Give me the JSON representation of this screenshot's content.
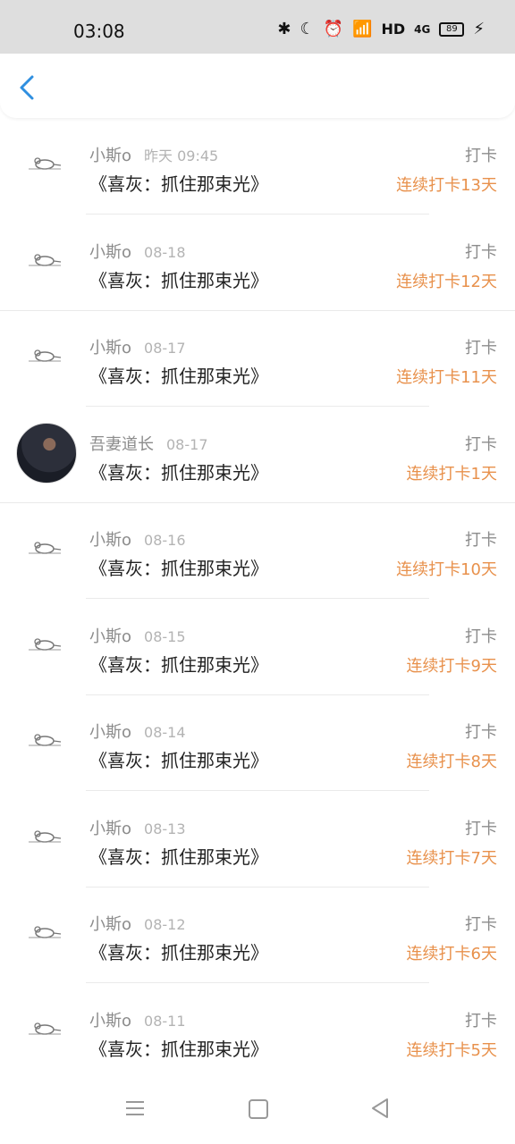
{
  "status": {
    "time": "03:08",
    "hd": "HD",
    "network": "4G",
    "battery": "89"
  },
  "header": {
    "back_label": "<"
  },
  "items": [
    {
      "user": "小斯o",
      "date": "昨天 09:45",
      "title": "《喜灰：抓住那束光》",
      "label": "打卡",
      "streak": "连续打卡13天",
      "avatar": "mouse-icon"
    },
    {
      "user": "小斯o",
      "date": "08-18",
      "title": "《喜灰：抓住那束光》",
      "label": "打卡",
      "streak": "连续打卡12天",
      "avatar": "mouse-icon"
    },
    {
      "user": "小斯o",
      "date": "08-17",
      "title": "《喜灰：抓住那束光》",
      "label": "打卡",
      "streak": "连续打卡11天",
      "avatar": "mouse-icon"
    },
    {
      "user": "吾妻道长",
      "date": "08-17",
      "title": "《喜灰：抓住那束光》",
      "label": "打卡",
      "streak": "连续打卡1天",
      "avatar": "photo"
    },
    {
      "user": "小斯o",
      "date": "08-16",
      "title": "《喜灰：抓住那束光》",
      "label": "打卡",
      "streak": "连续打卡10天",
      "avatar": "mouse-icon"
    },
    {
      "user": "小斯o",
      "date": "08-15",
      "title": "《喜灰：抓住那束光》",
      "label": "打卡",
      "streak": "连续打卡9天",
      "avatar": "mouse-icon"
    },
    {
      "user": "小斯o",
      "date": "08-14",
      "title": "《喜灰：抓住那束光》",
      "label": "打卡",
      "streak": "连续打卡8天",
      "avatar": "mouse-icon"
    },
    {
      "user": "小斯o",
      "date": "08-13",
      "title": "《喜灰：抓住那束光》",
      "label": "打卡",
      "streak": "连续打卡7天",
      "avatar": "mouse-icon"
    },
    {
      "user": "小斯o",
      "date": "08-12",
      "title": "《喜灰：抓住那束光》",
      "label": "打卡",
      "streak": "连续打卡6天",
      "avatar": "mouse-icon"
    },
    {
      "user": "小斯o",
      "date": "08-11",
      "title": "《喜灰：抓住那束光》",
      "label": "打卡",
      "streak": "连续打卡5天",
      "avatar": "mouse-icon"
    }
  ],
  "colors": {
    "accent": "#2f8fe0",
    "streak": "#e8914c"
  }
}
